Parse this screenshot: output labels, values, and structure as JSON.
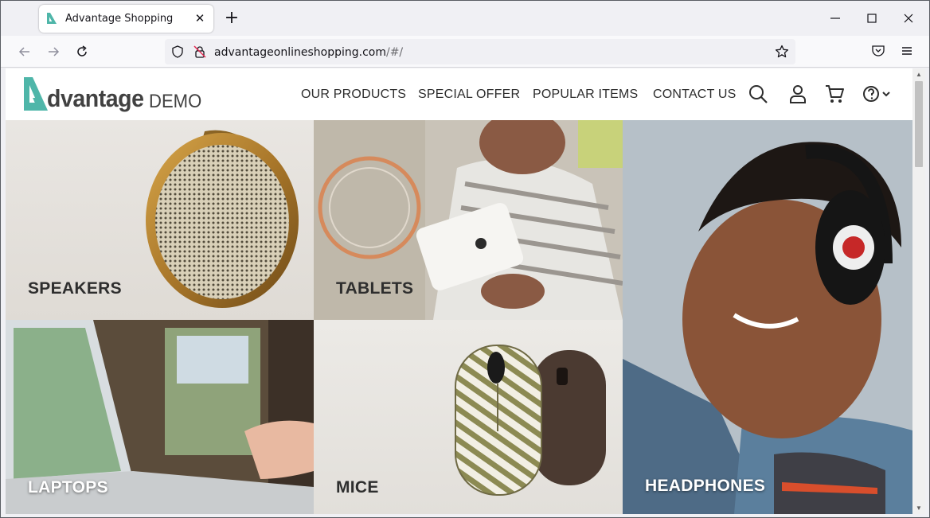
{
  "browser": {
    "tab": {
      "title": "Advantage Shopping",
      "close_glyph": "✕"
    },
    "new_tab_glyph": "+",
    "url": {
      "host": "advantageonlineshopping.com",
      "path": "/#/"
    },
    "icons": [
      "back-arrow-icon",
      "forward-arrow-icon",
      "reload-icon",
      "shield-icon",
      "permissions-icon",
      "star-icon",
      "pocket-icon",
      "hamburger-menu-icon",
      "minimize-icon",
      "maximize-icon",
      "close-icon"
    ]
  },
  "site": {
    "logo": {
      "mark": "A",
      "word": "dvantage",
      "suffix": "DEMO"
    },
    "menu": [
      "OUR PRODUCTS",
      "SPECIAL OFFER",
      "POPULAR ITEMS",
      "CONTACT US"
    ],
    "icons": [
      "search-icon",
      "user-icon",
      "cart-icon",
      "help-icon",
      "chevron-down-icon"
    ]
  },
  "categories": [
    {
      "label": "SPEAKERS"
    },
    {
      "label": "TABLETS"
    },
    {
      "label": "HEADPHONES"
    },
    {
      "label": "LAPTOPS"
    },
    {
      "label": "MICE"
    }
  ],
  "colors": {
    "brand_teal": "#4fb6a9",
    "text_dark": "#2d2d2d",
    "browser_chrome": "#f0f0f4"
  }
}
